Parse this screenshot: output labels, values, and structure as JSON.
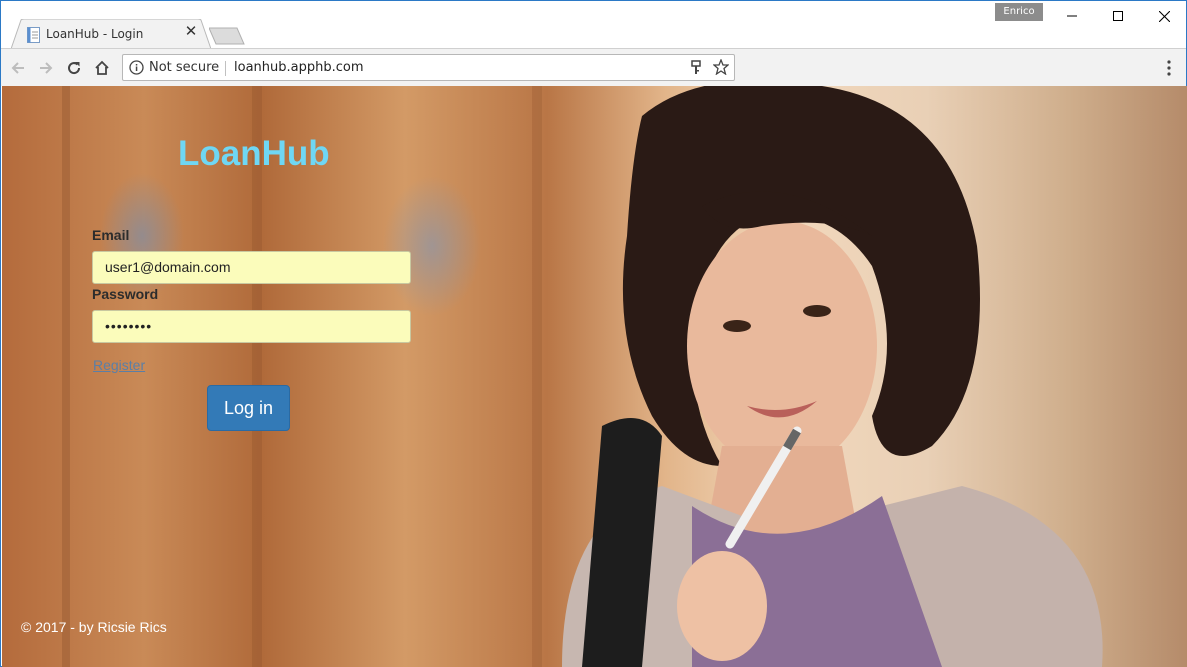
{
  "browser": {
    "tab_title": "LoanHub - Login",
    "profile_name": "Enrico",
    "security_label": "Not secure",
    "url": "loanhub.apphb.com"
  },
  "page": {
    "brand": "LoanHub",
    "email_label": "Email",
    "email_value": "user1@domain.com",
    "password_label": "Password",
    "password_value": "••••••••",
    "register_link": "Register",
    "login_button": "Log in",
    "footer": "© 2017 - by Ricsie Rics"
  },
  "colors": {
    "brand": "#6fd7f4",
    "button": "#337ab7",
    "field_bg": "#fbfcbb",
    "link": "#5b7fa6"
  }
}
